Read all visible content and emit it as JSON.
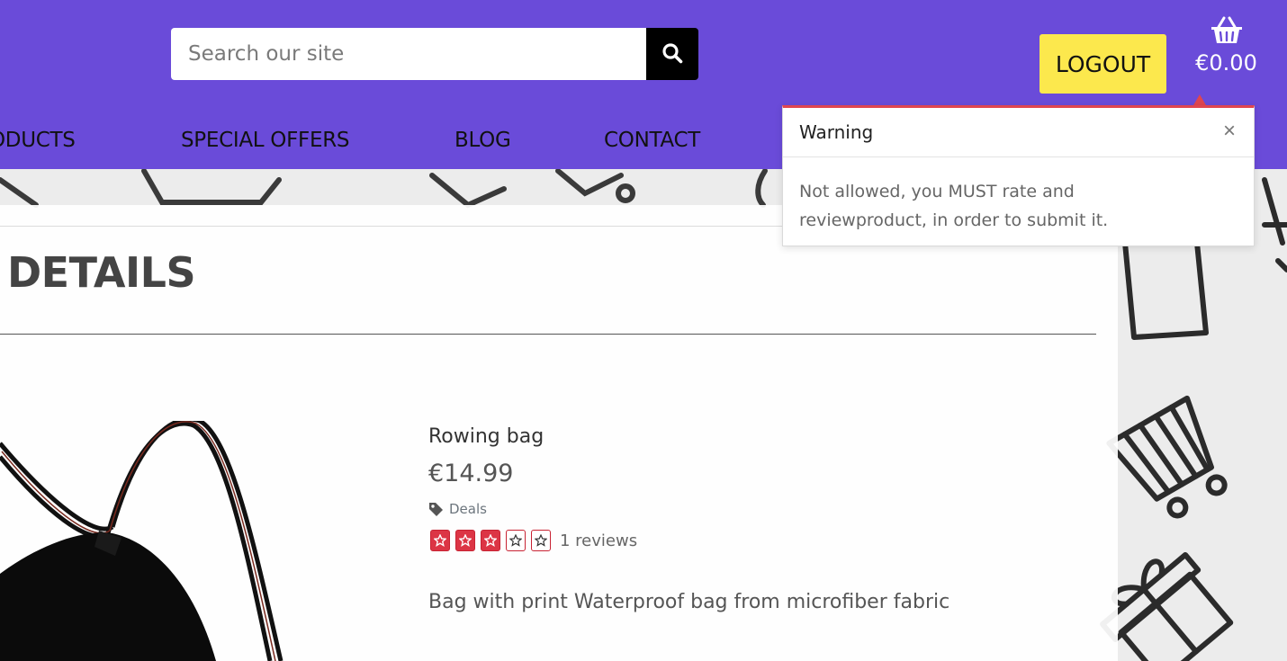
{
  "header": {
    "search": {
      "placeholder": "Search our site",
      "value": ""
    },
    "logout_label": "LOGOUT",
    "cart_total": "€0.00"
  },
  "nav": {
    "items": [
      {
        "label": "ODUCTS"
      },
      {
        "label": "SPECIAL OFFERS"
      },
      {
        "label": "BLOG"
      },
      {
        "label": "CONTACT"
      }
    ]
  },
  "page": {
    "title": "DETAILS"
  },
  "product": {
    "name": "Rowing bag",
    "price": "€14.99",
    "category": "Deals",
    "rating": 3,
    "rating_max": 5,
    "reviews_label": "1 reviews",
    "description": "Bag with print Waterproof bag from microfiber fabric"
  },
  "toast": {
    "title": "Warning",
    "message": "Not allowed, you MUST rate and reviewproduct, in order to submit it.",
    "close_symbol": "×"
  },
  "colors": {
    "header_bg": "#6a4bd9",
    "logout_bg": "#fce84d",
    "star_red": "#dc3545",
    "toast_accent": "#e0454f"
  }
}
